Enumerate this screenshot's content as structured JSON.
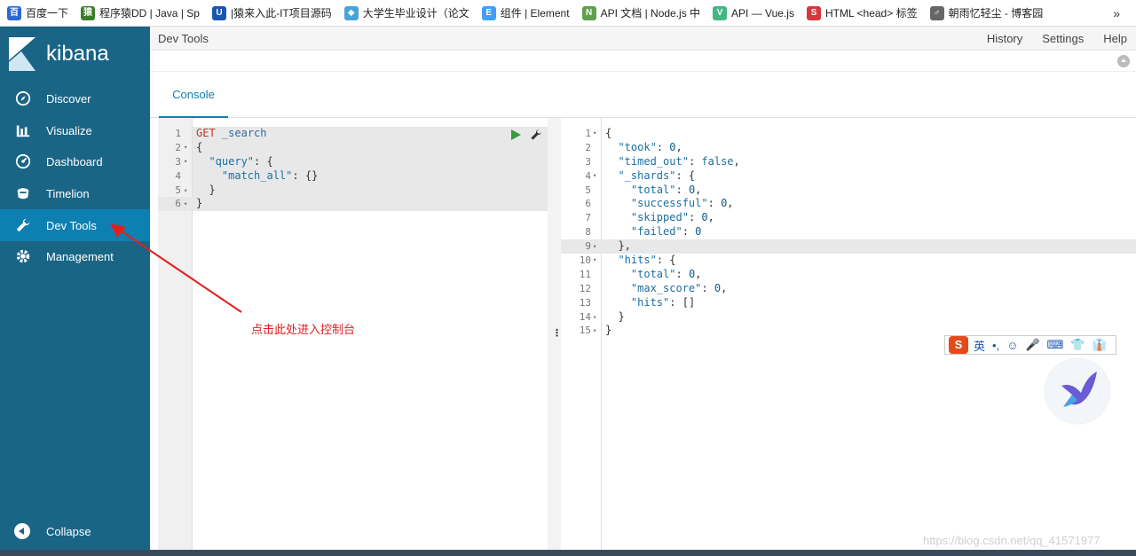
{
  "bookmarks": [
    {
      "label": "百度一下",
      "color": "#2d67d6",
      "glyph": "百"
    },
    {
      "label": "程序猿DD | Java | Sp",
      "color": "#3a7d2a",
      "glyph": "猿"
    },
    {
      "label": "|猿来入此-IT项目源码",
      "color": "#1a56b0",
      "glyph": "U"
    },
    {
      "label": "大学生毕业设计（论文",
      "color": "#4aa3d6",
      "glyph": "◆"
    },
    {
      "label": "组件 | Element",
      "color": "#409eff",
      "glyph": "E"
    },
    {
      "label": "API 文档 | Node.js 中",
      "color": "#5fa04e",
      "glyph": "N"
    },
    {
      "label": "API — Vue.js",
      "color": "#41b883",
      "glyph": "V"
    },
    {
      "label": "HTML <head> 标签",
      "color": "#d9363e",
      "glyph": "S"
    },
    {
      "label": "朝雨忆轻尘 - 博客园",
      "color": "#666666",
      "glyph": "♂"
    }
  ],
  "bookmarks_more": "»",
  "app": {
    "name": "kibana"
  },
  "sidebar": {
    "items": [
      {
        "label": "Discover",
        "icon": "compass-icon"
      },
      {
        "label": "Visualize",
        "icon": "bar-chart-icon"
      },
      {
        "label": "Dashboard",
        "icon": "dashboard-icon"
      },
      {
        "label": "Timelion",
        "icon": "timelion-icon"
      },
      {
        "label": "Dev Tools",
        "icon": "wrench-icon",
        "active": true
      },
      {
        "label": "Management",
        "icon": "gear-icon"
      }
    ],
    "collapse_label": "Collapse"
  },
  "header": {
    "title": "Dev Tools",
    "links": [
      "History",
      "Settings",
      "Help"
    ]
  },
  "tabs": {
    "console": "Console"
  },
  "request_editor": {
    "lines": [
      {
        "n": "1",
        "fold": "",
        "text": "GET _search"
      },
      {
        "n": "2",
        "fold": "▾",
        "text": "{"
      },
      {
        "n": "3",
        "fold": "▾",
        "text": "  \"query\": {"
      },
      {
        "n": "4",
        "fold": "",
        "text": "    \"match_all\": {}"
      },
      {
        "n": "5",
        "fold": "▴",
        "text": "  }"
      },
      {
        "n": "6",
        "fold": "▴",
        "text": "}"
      }
    ]
  },
  "response_editor": {
    "lines": [
      {
        "n": "1",
        "fold": "▾",
        "text": "{"
      },
      {
        "n": "2",
        "fold": "",
        "text": "  \"took\": 0,"
      },
      {
        "n": "3",
        "fold": "",
        "text": "  \"timed_out\": false,"
      },
      {
        "n": "4",
        "fold": "▾",
        "text": "  \"_shards\": {"
      },
      {
        "n": "5",
        "fold": "",
        "text": "    \"total\": 0,"
      },
      {
        "n": "6",
        "fold": "",
        "text": "    \"successful\": 0,"
      },
      {
        "n": "7",
        "fold": "",
        "text": "    \"skipped\": 0,"
      },
      {
        "n": "8",
        "fold": "",
        "text": "    \"failed\": 0"
      },
      {
        "n": "9",
        "fold": "▴",
        "text": "  },"
      },
      {
        "n": "10",
        "fold": "▾",
        "text": "  \"hits\": {"
      },
      {
        "n": "11",
        "fold": "",
        "text": "    \"total\": 0,"
      },
      {
        "n": "12",
        "fold": "",
        "text": "    \"max_score\": 0,"
      },
      {
        "n": "13",
        "fold": "",
        "text": "    \"hits\": []"
      },
      {
        "n": "14",
        "fold": "▴",
        "text": "  }"
      },
      {
        "n": "15",
        "fold": "▴",
        "text": "}"
      }
    ]
  },
  "annotation": {
    "text": "点击此处进入控制台",
    "color": "#e02020"
  },
  "resizer_glyph": "⋮",
  "ime": {
    "logo": "S",
    "mode": "英",
    "items": [
      "•,",
      "☺",
      "🎤",
      "⌨",
      "👕",
      "👔"
    ]
  },
  "watermark": "https://blog.csdn.net/qq_41571977",
  "colors": {
    "sidebar": "#1a6586",
    "active": "#0e7fb1",
    "accent": "#0e7fb1"
  }
}
